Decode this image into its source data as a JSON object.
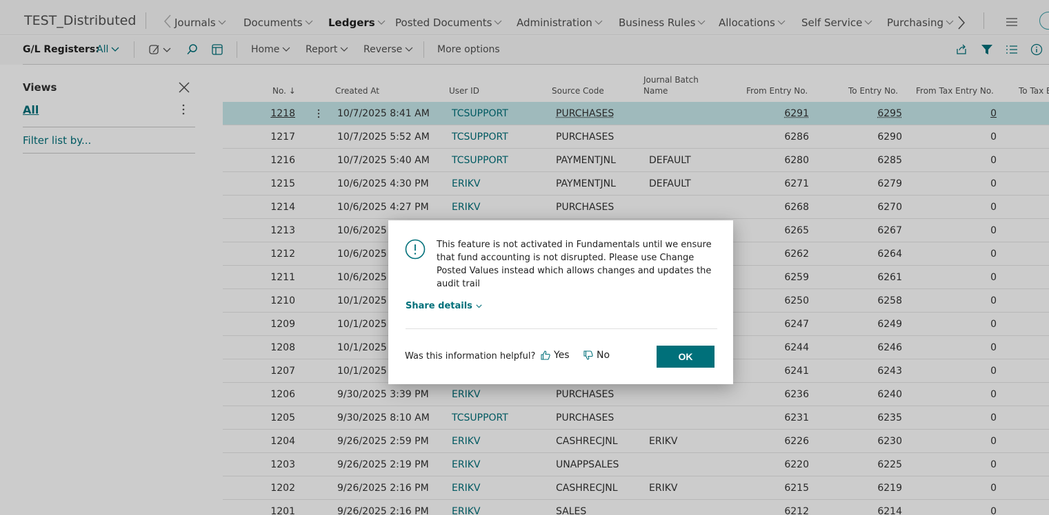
{
  "nav": {
    "company": "TEST_Distributed",
    "items": [
      {
        "label": "Journals",
        "bold": false
      },
      {
        "label": "Documents",
        "bold": false
      },
      {
        "label": "Ledgers",
        "bold": true
      },
      {
        "label": "Posted Documents",
        "bold": false
      },
      {
        "label": "Administration",
        "bold": false
      },
      {
        "label": "Business Rules",
        "bold": false
      },
      {
        "label": "Allocations",
        "bold": false
      },
      {
        "label": "Self Service",
        "bold": false
      },
      {
        "label": "Purchasing",
        "bold": false
      }
    ]
  },
  "actionbar": {
    "page_label": "G/L Registers:",
    "filter_value": "All",
    "home": "Home",
    "report": "Report",
    "reverse": "Reverse",
    "more": "More options"
  },
  "views": {
    "title": "Views",
    "all": "All",
    "filter": "Filter list by..."
  },
  "columns": {
    "no": "No. ↓",
    "created_at": "Created At",
    "user_id": "User ID",
    "source_code": "Source Code",
    "batch_line1": "Journal Batch",
    "batch_line2": "Name",
    "from_entry": "From Entry No.",
    "to_entry": "To Entry No.",
    "from_tax": "From Tax Entry No.",
    "to_tax": "To Tax E"
  },
  "rows": [
    {
      "no": "1218",
      "created": "10/7/2025 8:41 AM",
      "user": "TCSUPPORT",
      "source": "PURCHASES",
      "batch": "",
      "from": "6291",
      "to": "6295",
      "tax": "0"
    },
    {
      "no": "1217",
      "created": "10/7/2025 5:52 AM",
      "user": "TCSUPPORT",
      "source": "PURCHASES",
      "batch": "",
      "from": "6286",
      "to": "6290",
      "tax": "0"
    },
    {
      "no": "1216",
      "created": "10/7/2025 5:40 AM",
      "user": "TCSUPPORT",
      "source": "PAYMENTJNL",
      "batch": "DEFAULT",
      "from": "6280",
      "to": "6285",
      "tax": "0"
    },
    {
      "no": "1215",
      "created": "10/6/2025 4:30 PM",
      "user": "ERIKV",
      "source": "PAYMENTJNL",
      "batch": "DEFAULT",
      "from": "6271",
      "to": "6279",
      "tax": "0"
    },
    {
      "no": "1214",
      "created": "10/6/2025 4:27 PM",
      "user": "ERIKV",
      "source": "PURCHASES",
      "batch": "",
      "from": "6268",
      "to": "6270",
      "tax": "0"
    },
    {
      "no": "1213",
      "created": "10/6/2025 4",
      "user": "",
      "source": "",
      "batch": "",
      "from": "6265",
      "to": "6267",
      "tax": "0"
    },
    {
      "no": "1212",
      "created": "10/6/2025 4",
      "user": "",
      "source": "",
      "batch": "",
      "from": "6262",
      "to": "6264",
      "tax": "0"
    },
    {
      "no": "1211",
      "created": "10/6/2025 4",
      "user": "",
      "source": "",
      "batch": "",
      "from": "6259",
      "to": "6261",
      "tax": "0"
    },
    {
      "no": "1210",
      "created": "10/1/2025 1",
      "user": "",
      "source": "",
      "batch": "",
      "from": "6250",
      "to": "6258",
      "tax": "0"
    },
    {
      "no": "1209",
      "created": "10/1/2025 1",
      "user": "",
      "source": "",
      "batch": "",
      "from": "6247",
      "to": "6249",
      "tax": "0"
    },
    {
      "no": "1208",
      "created": "10/1/2025 1",
      "user": "",
      "source": "",
      "batch": "",
      "from": "6244",
      "to": "6246",
      "tax": "0"
    },
    {
      "no": "1207",
      "created": "10/1/2025 1",
      "user": "",
      "source": "",
      "batch": "",
      "from": "6241",
      "to": "6243",
      "tax": "0"
    },
    {
      "no": "1206",
      "created": "9/30/2025 3:39 PM",
      "user": "ERIKV",
      "source": "PURCHASES",
      "batch": "",
      "from": "6236",
      "to": "6240",
      "tax": "0"
    },
    {
      "no": "1205",
      "created": "9/30/2025 8:10 AM",
      "user": "TCSUPPORT",
      "source": "PURCHASES",
      "batch": "",
      "from": "6231",
      "to": "6235",
      "tax": "0"
    },
    {
      "no": "1204",
      "created": "9/26/2025 2:59 PM",
      "user": "ERIKV",
      "source": "CASHRECJNL",
      "batch": "ERIKV",
      "from": "6226",
      "to": "6230",
      "tax": "0"
    },
    {
      "no": "1203",
      "created": "9/26/2025 2:19 PM",
      "user": "ERIKV",
      "source": "UNAPPSALES",
      "batch": "",
      "from": "6220",
      "to": "6225",
      "tax": "0"
    },
    {
      "no": "1202",
      "created": "9/26/2025 2:16 PM",
      "user": "ERIKV",
      "source": "CASHRECJNL",
      "batch": "ERIKV",
      "from": "6215",
      "to": "6219",
      "tax": "0"
    },
    {
      "no": "1201",
      "created": "9/26/2025 2:16 PM",
      "user": "ERIKV",
      "source": "SALES",
      "batch": "",
      "from": "6212",
      "to": "6214",
      "tax": "0"
    }
  ],
  "dialog": {
    "message": "This feature is not activated in Fundamentals until we ensure that fund accounting is not disrupted. Please use Change Posted Values instead which allows changes and updates the audit trail",
    "share": "Share details",
    "helpful": "Was this information helpful?",
    "yes": "Yes",
    "no": "No",
    "ok": "OK"
  },
  "colors": {
    "accent": "#00707a",
    "selected_row": "#c7e9ec"
  }
}
